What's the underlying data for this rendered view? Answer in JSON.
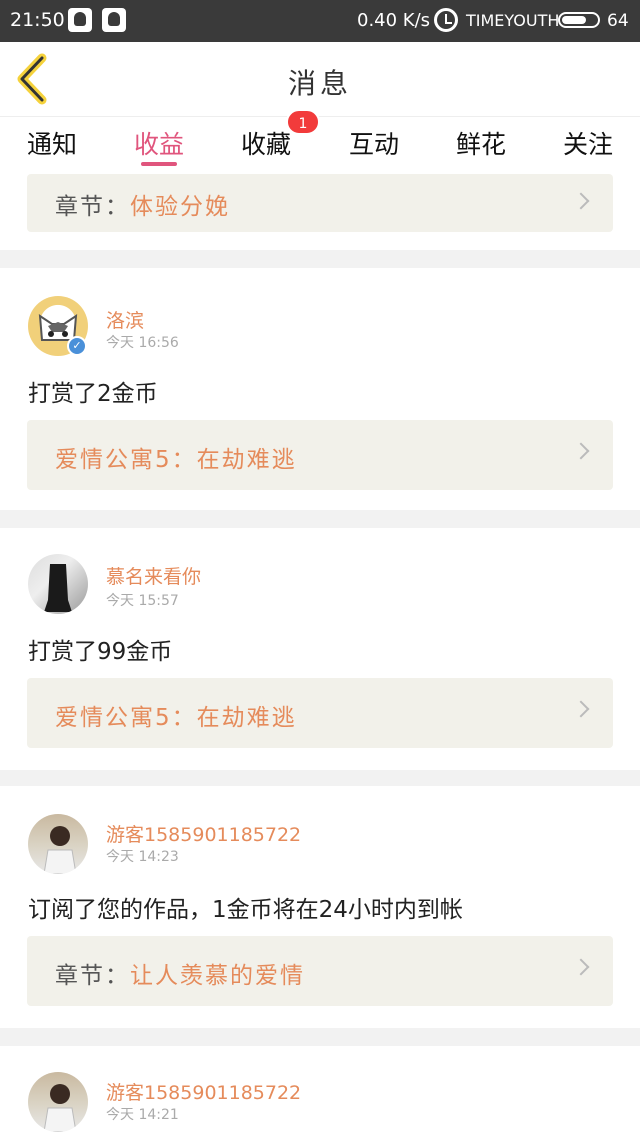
{
  "status_bar": {
    "time": "21:50",
    "speed": "0.40 K/s",
    "carrier": "TIMEYOUTH",
    "battery": "64"
  },
  "header": {
    "title": "消息"
  },
  "tabs": [
    {
      "label": "通知"
    },
    {
      "label": "收益"
    },
    {
      "label": "收藏"
    },
    {
      "label": "互动"
    },
    {
      "label": "鲜花"
    },
    {
      "label": "关注"
    }
  ],
  "badge": "1",
  "top_ref": {
    "prefix": "章节：",
    "title": "体验分娩"
  },
  "items": [
    {
      "username": "洛滨",
      "time": "今天 16:56",
      "action": "打赏了2金币",
      "ref_prefix": "",
      "ref_title": "爱情公寓5：在劫难逃"
    },
    {
      "username": "慕名来看你",
      "time": "今天 15:57",
      "action": "打赏了99金币",
      "ref_prefix": "",
      "ref_title": "爱情公寓5：在劫难逃"
    },
    {
      "username": "游客15859011857​22",
      "time": "今天 14:23",
      "action": "订阅了您的作品，1金币将在24小时内到帐",
      "ref_prefix": "章节：",
      "ref_title": "让人羡慕的爱情"
    },
    {
      "username": "游客15859011857​22",
      "time": "今天 14:21",
      "action": "",
      "ref_prefix": "",
      "ref_title": ""
    }
  ],
  "colors": {
    "accent": "#e0557d",
    "name": "#e58b5b",
    "badge": "#f23b3b"
  }
}
